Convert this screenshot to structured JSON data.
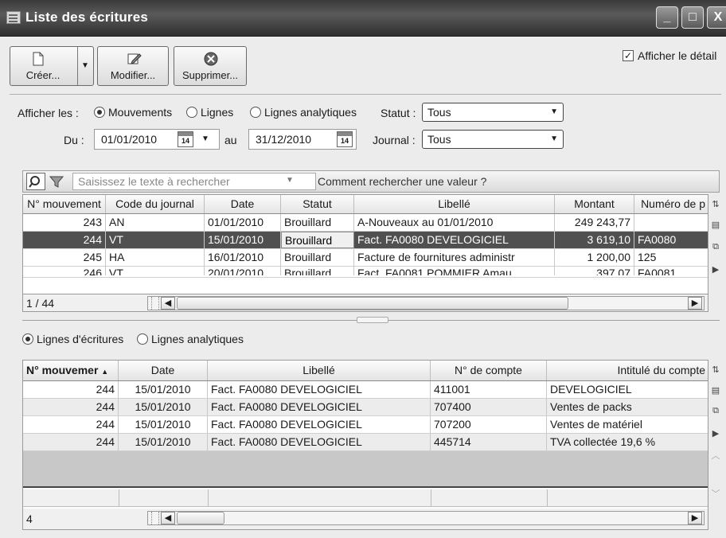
{
  "window": {
    "title": "Liste des écritures",
    "controls": {
      "minimize": "_",
      "maximize": "□",
      "close": "X"
    }
  },
  "toolbar": {
    "create_label": "Créer...",
    "modify_label": "Modifier...",
    "delete_label": "Supprimer...",
    "show_detail_label": "Afficher le détail",
    "show_detail_checked": true
  },
  "filters": {
    "afficher_label": "Afficher les :",
    "radio_mouvements": "Mouvements",
    "radio_lignes": "Lignes",
    "radio_lignes_analytiques": "Lignes analytiques",
    "statut_label": "Statut :",
    "statut_value": "Tous",
    "du_label": "Du :",
    "date_from": "01/01/2010",
    "au_label": "au",
    "date_to": "31/12/2010",
    "calendar_day": "14",
    "journal_label": "Journal :",
    "journal_value": "Tous"
  },
  "search": {
    "placeholder": "Saisissez le texte à rechercher",
    "help_link": "Comment rechercher une valeur ?"
  },
  "top_grid": {
    "columns": [
      "N° mouvement",
      "Code du journal",
      "Date",
      "Statut",
      "Libellé",
      "Montant",
      "Numéro de p"
    ],
    "rows": [
      {
        "num": "243",
        "journal": "AN",
        "date": "01/01/2010",
        "statut": "Brouillard",
        "libelle": "A-Nouveaux au 01/01/2010",
        "montant": "249 243,77",
        "numero": ""
      },
      {
        "num": "244",
        "journal": "VT",
        "date": "15/01/2010",
        "statut": "Brouillard",
        "libelle": "Fact. FA0080 DEVELOGICIEL",
        "montant": "3 619,10",
        "numero": "FA0080"
      },
      {
        "num": "245",
        "journal": "HA",
        "date": "16/01/2010",
        "statut": "Brouillard",
        "libelle": "Facture de fournitures administr",
        "montant": "1 200,00",
        "numero": "125"
      },
      {
        "num": "246",
        "journal": "VT",
        "date": "20/01/2010",
        "statut": "Brouillard",
        "libelle": "Fact. FA0081 POMMIER Amau",
        "montant": "397,07",
        "numero": "FA0081"
      }
    ],
    "page_indicator": "1 / 44"
  },
  "lines_toggle": {
    "radio_lignes_ecritures": "Lignes d'écritures",
    "radio_lignes_analytiques": "Lignes analytiques"
  },
  "bottom_grid": {
    "columns": [
      "N° mouvemer",
      "Date",
      "Libellé",
      "N° de compte",
      "Intitulé du compte"
    ],
    "rows": [
      {
        "num": "244",
        "date": "15/01/2010",
        "libelle": "Fact. FA0080 DEVELOGICIEL",
        "compte": "411001",
        "intitule": "DEVELOGICIEL"
      },
      {
        "num": "244",
        "date": "15/01/2010",
        "libelle": "Fact. FA0080 DEVELOGICIEL",
        "compte": "707400",
        "intitule": "Ventes de packs"
      },
      {
        "num": "244",
        "date": "15/01/2010",
        "libelle": "Fact. FA0080 DEVELOGICIEL",
        "compte": "707200",
        "intitule": "Ventes de matériel"
      },
      {
        "num": "244",
        "date": "15/01/2010",
        "libelle": "Fact. FA0080 DEVELOGICIEL",
        "compte": "445714",
        "intitule": "TVA collectée 19,6 %"
      }
    ],
    "count": "4"
  },
  "icons": [
    "window-icon",
    "new-document-icon",
    "edit-icon",
    "delete-icon",
    "search-icon",
    "filter-icon",
    "calendar-icon",
    "column-chooser-icon",
    "print-icon",
    "export-icon",
    "expand-icon"
  ]
}
